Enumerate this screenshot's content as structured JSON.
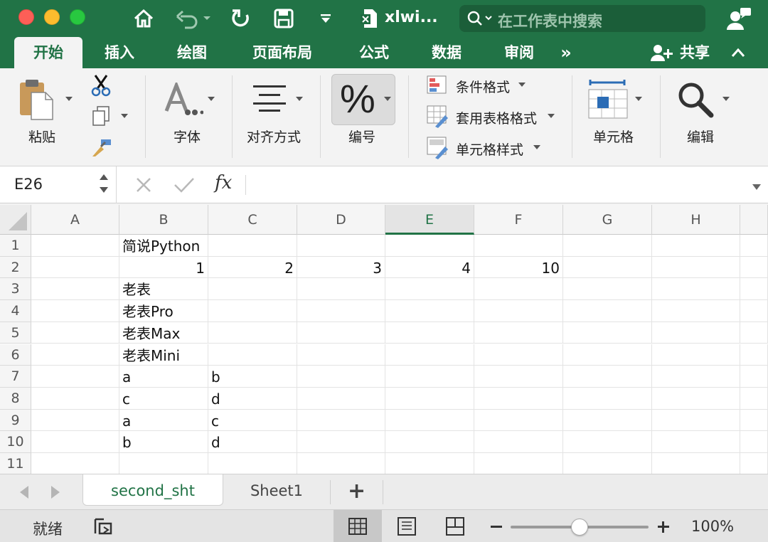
{
  "window": {
    "doc_title": "xlwi...",
    "search_placeholder": "在工作表中搜索"
  },
  "ribbon_tabs": [
    {
      "label": "开始",
      "active": true
    },
    {
      "label": "插入"
    },
    {
      "label": "绘图"
    },
    {
      "label": "页面布局"
    },
    {
      "label": "公式"
    },
    {
      "label": "数据"
    },
    {
      "label": "审阅"
    },
    {
      "label": "»"
    }
  ],
  "share_label": "共享",
  "ribbon": {
    "paste": "粘贴",
    "font": "字体",
    "alignment": "对齐方式",
    "number": "编号",
    "conditional_format": "条件格式",
    "format_as_table": "套用表格格式",
    "cell_styles": "单元格样式",
    "cells": "单元格",
    "editing": "编辑"
  },
  "formula_bar": {
    "name_box": "E26",
    "fx": "fx",
    "value": ""
  },
  "grid": {
    "selected_column": "E",
    "columns": [
      "A",
      "B",
      "C",
      "D",
      "E",
      "F",
      "G",
      "H"
    ],
    "rows": [
      "1",
      "2",
      "3",
      "4",
      "5",
      "6",
      "7",
      "8",
      "9",
      "10",
      "11"
    ],
    "cells": {
      "B1": "简说Python",
      "B2": "1",
      "C2": "2",
      "D2": "3",
      "E2": "4",
      "F2": "10",
      "B3": "老表",
      "B4": "老表Pro",
      "B5": "老表Max",
      "B6": "老表Mini",
      "B7": "a",
      "C7": "b",
      "B8": "c",
      "C8": "d",
      "B9": "a",
      "C9": "c",
      "B10": "b",
      "C10": "d"
    }
  },
  "sheets": [
    {
      "name": "second_sht",
      "active": true
    },
    {
      "name": "Sheet1"
    }
  ],
  "add_sheet": "+",
  "status": {
    "ready": "就绪",
    "zoom": "100%",
    "zoom_fraction": 0.5
  },
  "colors": {
    "accent": "#217346",
    "ribbon_bg": "#f3f3f3"
  }
}
